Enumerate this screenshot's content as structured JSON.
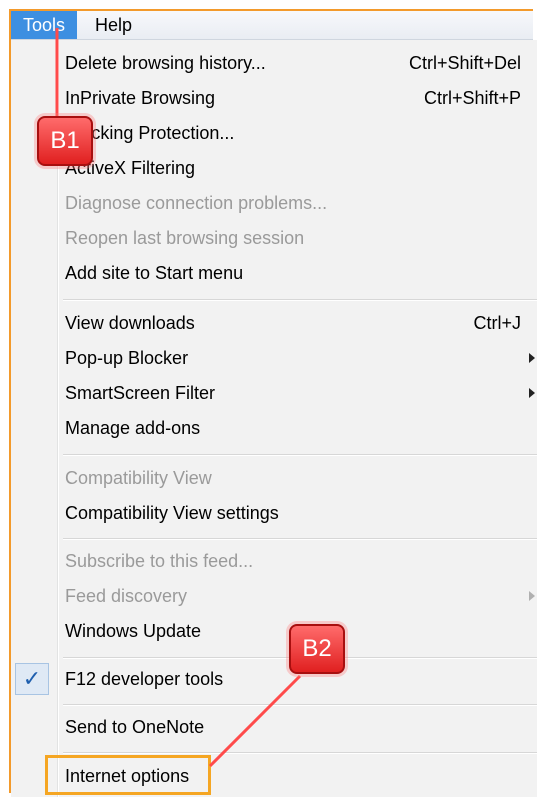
{
  "menubar": {
    "items": [
      {
        "label": "Tools",
        "active": true
      },
      {
        "label": "Help",
        "active": false
      }
    ]
  },
  "menu": {
    "items": [
      {
        "label": "Delete browsing history...",
        "shortcut": "Ctrl+Shift+Del",
        "disabled": false
      },
      {
        "label": "InPrivate Browsing",
        "shortcut": "Ctrl+Shift+P",
        "disabled": false
      },
      {
        "label": "Tracking Protection...",
        "shortcut": "",
        "disabled": false
      },
      {
        "label": "ActiveX Filtering",
        "shortcut": "",
        "disabled": false
      },
      {
        "label": "Diagnose connection problems...",
        "shortcut": "",
        "disabled": true
      },
      {
        "label": "Reopen last browsing session",
        "shortcut": "",
        "disabled": true
      },
      {
        "label": "Add site to Start menu",
        "shortcut": "",
        "disabled": false
      },
      {
        "label": "View downloads",
        "shortcut": "Ctrl+J",
        "disabled": false
      },
      {
        "label": "Pop-up Blocker",
        "shortcut": "",
        "disabled": false,
        "submenu": true
      },
      {
        "label": "SmartScreen Filter",
        "shortcut": "",
        "disabled": false,
        "submenu": true
      },
      {
        "label": "Manage add-ons",
        "shortcut": "",
        "disabled": false
      },
      {
        "label": "Compatibility View",
        "shortcut": "",
        "disabled": true
      },
      {
        "label": "Compatibility View settings",
        "shortcut": "",
        "disabled": false
      },
      {
        "label": "Subscribe to this feed...",
        "shortcut": "",
        "disabled": true
      },
      {
        "label": "Feed discovery",
        "shortcut": "",
        "disabled": true,
        "submenu": true
      },
      {
        "label": "Windows Update",
        "shortcut": "",
        "disabled": false
      },
      {
        "label": "F12 developer tools",
        "shortcut": "",
        "disabled": false,
        "checked": true
      },
      {
        "label": "Send to OneNote",
        "shortcut": "",
        "disabled": false
      },
      {
        "label": "Internet options",
        "shortcut": "",
        "disabled": false,
        "highlighted": true
      }
    ]
  },
  "annotations": {
    "b1": "B1",
    "b2": "B2"
  },
  "colors": {
    "active_menu": "#3d8fe1",
    "highlight_box": "#f5a623",
    "callout_red": "#e02020",
    "disabled_text": "#9a9a9a"
  },
  "icons": {
    "check": "checkmark-icon",
    "submenu": "submenu-arrow-icon"
  }
}
